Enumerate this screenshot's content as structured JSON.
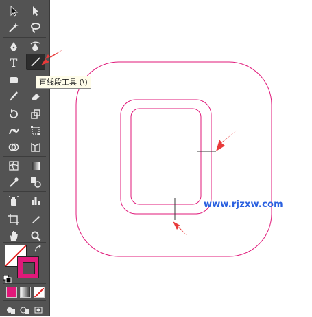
{
  "tooltip": {
    "text": "直线段工具 (\\)"
  },
  "watermark": {
    "text": "www.rjzxw.com"
  },
  "colors": {
    "panel": "#535353",
    "artwork_stroke": "#e0197a",
    "arrow": "#e83a3a",
    "fill_swatch": "#ffffff",
    "stroke_swatch": "#e0197a",
    "watermark": "#2b61e0"
  },
  "tools": [
    {
      "icon": "selection-arrow-icon"
    },
    {
      "icon": "direct-selection-icon"
    },
    {
      "icon": "magic-wand-icon"
    },
    {
      "icon": "lasso-icon"
    },
    {
      "icon": "pen-icon"
    },
    {
      "icon": "curvature-pen-icon"
    },
    {
      "icon": "type-icon",
      "label": "T"
    },
    {
      "icon": "line-segment-icon",
      "active": true
    },
    {
      "icon": "rectangle-icon"
    },
    {
      "icon": "paintbrush-icon"
    },
    {
      "icon": "rotate-icon"
    },
    {
      "icon": "scale-icon"
    },
    {
      "icon": "puppet-warp-icon"
    },
    {
      "icon": "free-transform-icon"
    },
    {
      "icon": "shape-builder-icon"
    },
    {
      "icon": "perspective-grid-icon"
    },
    {
      "icon": "mesh-icon"
    },
    {
      "icon": "gradient-icon"
    },
    {
      "icon": "eyedropper-icon"
    },
    {
      "icon": "blend-icon"
    },
    {
      "icon": "symbol-sprayer-icon"
    },
    {
      "icon": "column-graph-icon"
    },
    {
      "icon": "artboard-icon"
    },
    {
      "icon": "slice-icon"
    },
    {
      "icon": "hand-icon"
    },
    {
      "icon": "zoom-icon"
    }
  ]
}
